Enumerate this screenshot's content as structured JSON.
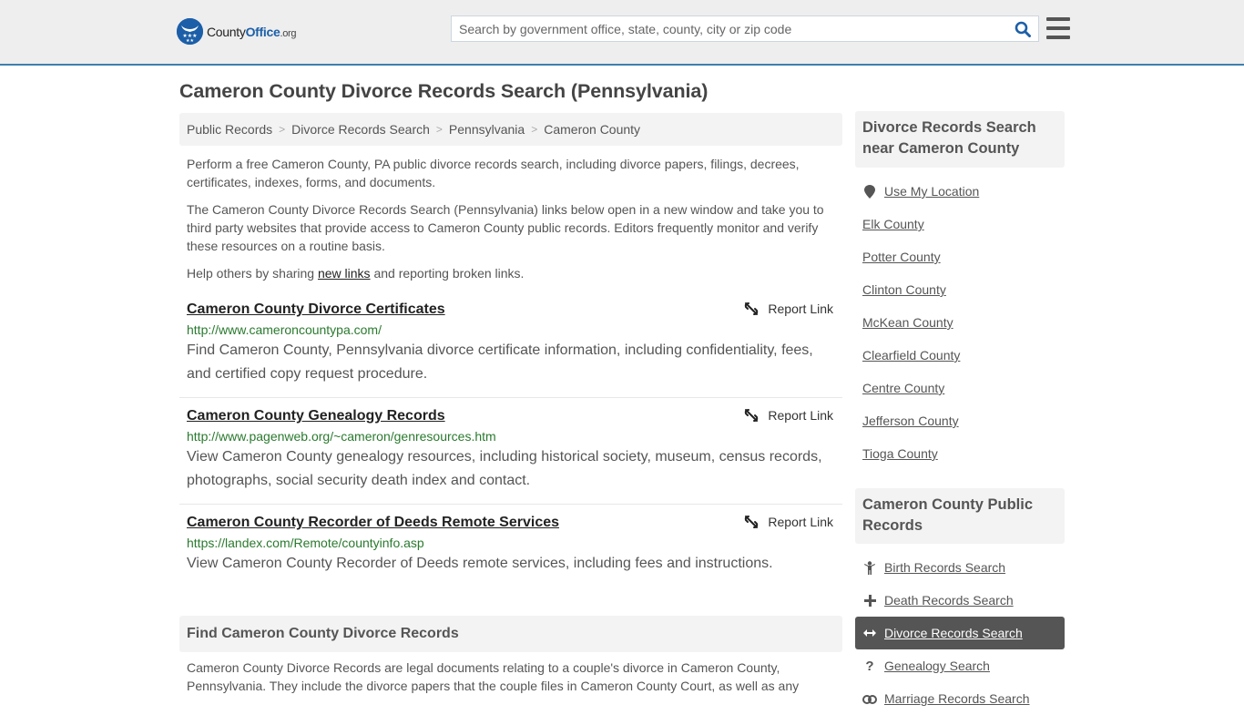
{
  "header": {
    "logo": {
      "part1": "County",
      "part2": "Office",
      "part3": ".org"
    },
    "search": {
      "placeholder": "Search by government office, state, county, city or zip code",
      "value": ""
    }
  },
  "page": {
    "title": "Cameron County Divorce Records Search (Pennsylvania)"
  },
  "breadcrumb": [
    {
      "label": "Public Records"
    },
    {
      "label": "Divorce Records Search"
    },
    {
      "label": "Pennsylvania"
    },
    {
      "label": "Cameron County"
    }
  ],
  "intro": {
    "p1": "Perform a free Cameron County, PA public divorce records search, including divorce papers, filings, decrees, certificates, indexes, forms, and documents.",
    "p2": "The Cameron County Divorce Records Search (Pennsylvania) links below open in a new window and take you to third party websites that provide access to Cameron County public records. Editors frequently monitor and verify these resources on a routine basis.",
    "p3_before": "Help others by sharing ",
    "p3_link": "new links",
    "p3_after": " and reporting broken links."
  },
  "report_label": "Report Link",
  "results": [
    {
      "title": "Cameron County Divorce Certificates",
      "url": "http://www.cameroncountypa.com/",
      "description": "Find Cameron County, Pennsylvania divorce certificate information, including confidentiality, fees, and certified copy request procedure."
    },
    {
      "title": "Cameron County Genealogy Records",
      "url": "http://www.pagenweb.org/~cameron/genresources.htm",
      "description": "View Cameron County genealogy resources, including historical society, museum, census records, photographs, social security death index and contact."
    },
    {
      "title": "Cameron County Recorder of Deeds Remote Services",
      "url": "https://landex.com/Remote/countyinfo.asp",
      "description": "View Cameron County Recorder of Deeds remote services, including fees and instructions."
    }
  ],
  "find_section": {
    "heading": "Find Cameron County Divorce Records",
    "body": "Cameron County Divorce Records are legal documents relating to a couple's divorce in Cameron County, Pennsylvania. They include the divorce papers that the couple files in Cameron County Court, as well as any"
  },
  "sidebar": {
    "nearby": {
      "heading": "Divorce Records Search near Cameron County",
      "location_label": "Use My Location",
      "counties": [
        "Elk County",
        "Potter County",
        "Clinton County",
        "McKean County",
        "Clearfield County",
        "Centre County",
        "Jefferson County",
        "Tioga County"
      ]
    },
    "public_records": {
      "heading": "Cameron County Public Records",
      "items": [
        {
          "label": "Birth Records Search",
          "icon": "child-icon",
          "active": false
        },
        {
          "label": "Death Records Search",
          "icon": "plus-icon",
          "active": false
        },
        {
          "label": "Divorce Records Search",
          "icon": "arrows-horizontal-icon",
          "active": true
        },
        {
          "label": "Genealogy Search",
          "icon": "question-icon",
          "active": false
        },
        {
          "label": "Marriage Records Search",
          "icon": "rings-icon",
          "active": false
        }
      ]
    }
  }
}
